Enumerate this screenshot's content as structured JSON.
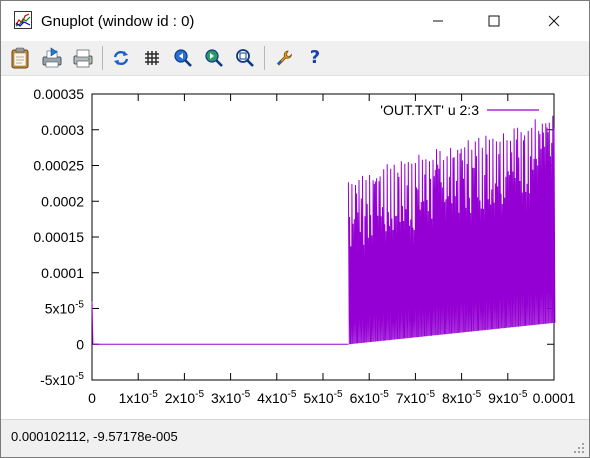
{
  "window": {
    "title": "Gnuplot (window id : 0)",
    "minimize_glyph": "—",
    "maximize_glyph": "☐",
    "close_glyph": "✕"
  },
  "toolbar": {
    "items": [
      {
        "name": "copy-to-clipboard",
        "icon": "clipboard-icon"
      },
      {
        "name": "print",
        "icon": "printer-export-icon"
      },
      {
        "name": "print-preview",
        "icon": "printer-icon"
      },
      {
        "name": "replot",
        "icon": "refresh-icon"
      },
      {
        "name": "toggle-grid",
        "icon": "grid-icon"
      },
      {
        "name": "zoom-previous",
        "icon": "zoom-previous-icon"
      },
      {
        "name": "zoom-next",
        "icon": "zoom-next-icon"
      },
      {
        "name": "autoscale",
        "icon": "autoscale-icon"
      },
      {
        "name": "options",
        "icon": "wrench-icon"
      },
      {
        "name": "help",
        "icon": "help-icon"
      }
    ],
    "help_glyph": "?"
  },
  "status": {
    "text": "0.000102112, -9.57178e-005"
  },
  "chart_data": {
    "type": "line",
    "title": "",
    "xlabel": "",
    "ylabel": "",
    "xlim": [
      0,
      0.0001
    ],
    "ylim": [
      -5e-05,
      0.00035
    ],
    "grid": false,
    "legend": {
      "position": "top-right",
      "entries": [
        "'OUT.TXT' u 2:3"
      ]
    },
    "series_color": "#9400d3",
    "x_tick_labels": [
      {
        "value": 0,
        "mant": "0",
        "exp": ""
      },
      {
        "value": 1e-05,
        "mant": "1x10",
        "exp": "-5"
      },
      {
        "value": 2e-05,
        "mant": "2x10",
        "exp": "-5"
      },
      {
        "value": 3e-05,
        "mant": "3x10",
        "exp": "-5"
      },
      {
        "value": 4e-05,
        "mant": "4x10",
        "exp": "-5"
      },
      {
        "value": 5e-05,
        "mant": "5x10",
        "exp": "-5"
      },
      {
        "value": 6e-05,
        "mant": "6x10",
        "exp": "-5"
      },
      {
        "value": 7e-05,
        "mant": "7x10",
        "exp": "-5"
      },
      {
        "value": 8e-05,
        "mant": "8x10",
        "exp": "-5"
      },
      {
        "value": 9e-05,
        "mant": "9x10",
        "exp": "-5"
      },
      {
        "value": 0.0001,
        "mant": "0.0001",
        "exp": ""
      }
    ],
    "y_tick_labels": [
      {
        "value": 0.00035,
        "mant": "0.00035",
        "exp": ""
      },
      {
        "value": 0.0003,
        "mant": "0.0003",
        "exp": ""
      },
      {
        "value": 0.00025,
        "mant": "0.00025",
        "exp": ""
      },
      {
        "value": 0.0002,
        "mant": "0.0002",
        "exp": ""
      },
      {
        "value": 0.00015,
        "mant": "0.00015",
        "exp": ""
      },
      {
        "value": 0.0001,
        "mant": "0.0001",
        "exp": ""
      },
      {
        "value": 5e-05,
        "mant": "5x10",
        "exp": "-5"
      },
      {
        "value": 0,
        "mant": "0",
        "exp": ""
      },
      {
        "value": -5e-05,
        "mant": "-5x10",
        "exp": "-5"
      }
    ],
    "series": [
      {
        "name": "'OUT.TXT' u 2:3",
        "segments": [
          {
            "x": [
              0,
              2e-07,
              4e-07
            ],
            "y": [
              6e-05,
              0.0,
              0.0
            ]
          },
          {
            "x": [
              4e-07,
              5.55e-05
            ],
            "y": [
              0.0,
              0.0
            ]
          }
        ],
        "oscillation": {
          "x_start": 5.55e-05,
          "x_end": 0.0001,
          "peak_start": 0.000235,
          "peak_end": 0.000325,
          "trough_start": 0.0,
          "trough_end": 3e-05,
          "mid_band_start": 0.000125,
          "mid_band_end": 0.00022
        }
      }
    ]
  }
}
